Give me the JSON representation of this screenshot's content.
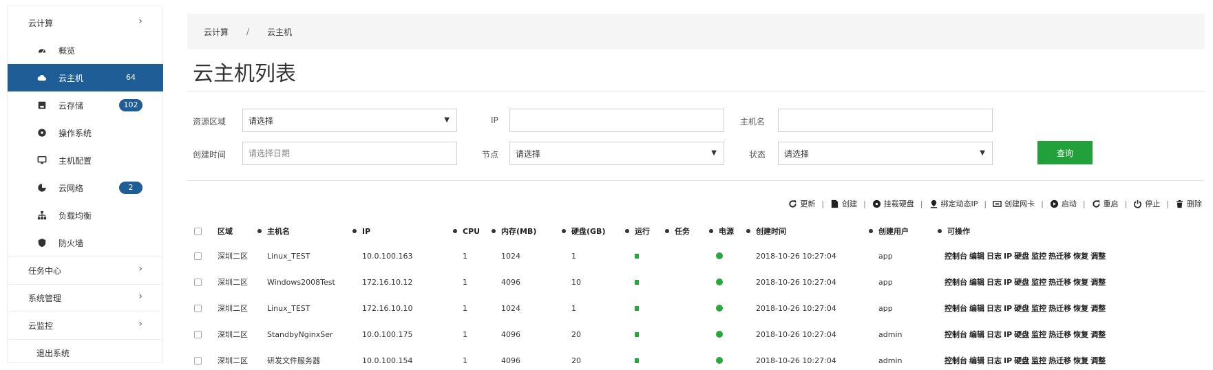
{
  "sidebar": {
    "cloud_group": "云计算",
    "items": [
      {
        "label": "概览",
        "icon": "dashboard-icon"
      },
      {
        "label": "云主机",
        "badge": "64",
        "icon": "cloud-icon",
        "active": true
      },
      {
        "label": "云存储",
        "badge": "102",
        "icon": "storage-icon"
      },
      {
        "label": "操作系统",
        "icon": "disc-icon"
      },
      {
        "label": "主机配置",
        "icon": "monitor-icon"
      },
      {
        "label": "云网络",
        "badge": "2",
        "icon": "network-icon"
      },
      {
        "label": "负载均衡",
        "icon": "sitemap-icon"
      },
      {
        "label": "防火墙",
        "icon": "shield-icon"
      }
    ],
    "groups": [
      "任务中心",
      "系统管理",
      "云监控"
    ],
    "exit": "退出系统"
  },
  "breadcrumb": {
    "root": "云计算",
    "separator": "/",
    "current": "云主机"
  },
  "page_title": "云主机列表",
  "filters": {
    "region_label": "资源区域",
    "region_value": "请选择",
    "ip_label": "IP",
    "ip_value": "",
    "hostname_label": "主机名",
    "hostname_value": "",
    "created_label": "创建时间",
    "created_placeholder": "请选择日期",
    "node_label": "节点",
    "node_value": "请选择",
    "status_label": "状态",
    "status_value": "请选择",
    "query_button": "查询"
  },
  "toolbar": {
    "refresh": "更新",
    "create": "创建",
    "attach_disk": "挂载硬盘",
    "bind_ip": "绑定动态IP",
    "create_nic": "创建网卡",
    "start": "启动",
    "restart": "重启",
    "stop": "停止",
    "delete": "删除"
  },
  "table": {
    "columns": [
      "区域",
      "主机名",
      "IP",
      "CPU",
      "内存(MB)",
      "硬盘(GB)",
      "运行",
      "任务",
      "电源",
      "创建时间",
      "创建用户",
      "可操作"
    ],
    "operations": [
      "控制台",
      "编辑",
      "日志",
      "IP",
      "硬盘",
      "监控",
      "热迁移",
      "恢复",
      "调整"
    ],
    "rows": [
      {
        "region": "深圳二区",
        "hostname": "Linux_TEST",
        "ip": "10.0.100.163",
        "cpu": "1",
        "memory": "1024",
        "disk": "1",
        "created": "2018-10-26 10:27:04",
        "user": "app"
      },
      {
        "region": "深圳二区",
        "hostname": "Windows2008Test",
        "ip": "172.16.10.12",
        "cpu": "1",
        "memory": "4096",
        "disk": "10",
        "created": "2018-10-26 10:27:04",
        "user": "app"
      },
      {
        "region": "深圳二区",
        "hostname": "Linux_TEST",
        "ip": "172.16.10.10",
        "cpu": "1",
        "memory": "1024",
        "disk": "1",
        "created": "2018-10-26 10:27:04",
        "user": "app"
      },
      {
        "region": "深圳二区",
        "hostname": "StandbyNginxSer",
        "ip": "10.0.100.175",
        "cpu": "1",
        "memory": "4096",
        "disk": "20",
        "created": "2018-10-26 10:27:04",
        "user": "admin"
      },
      {
        "region": "深圳二区",
        "hostname": "研发文件服务器",
        "ip": "10.0.100.154",
        "cpu": "1",
        "memory": "4096",
        "disk": "20",
        "created": "2018-10-26 10:27:04",
        "user": "admin"
      }
    ]
  },
  "colors": {
    "accent": "#1f5d97",
    "success": "#22a03a",
    "status_green": "#2aa63c"
  }
}
